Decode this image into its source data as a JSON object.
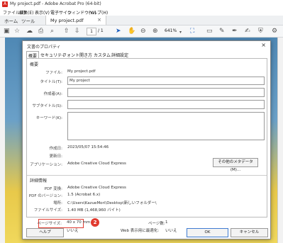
{
  "app": {
    "title": "My project.pdf - Adobe Acrobat Pro (64-bit)"
  },
  "menu": [
    "ファイル(F)",
    "編集(E)",
    "表示(V)",
    "電子サイン",
    "ウィンドウ(W)",
    "ヘルプ(H)"
  ],
  "tabs": {
    "home": "ホーム",
    "tools": "ツール",
    "document": "My project.pdf"
  },
  "toolbar": {
    "page_current": "1",
    "page_total": "/ 1",
    "zoom": "641%"
  },
  "dialog": {
    "title": "文書のプロパティ",
    "tabs": [
      "概要",
      "セキュリティ",
      "フォント",
      "開き方",
      "カスタム",
      "詳細設定"
    ],
    "overview_header": "概要",
    "labels": {
      "file": "ファイル:",
      "title": "タイトル(T):",
      "author": "作成者(A):",
      "subject": "サブタイトル(S):",
      "keywords": "キーワード(K):",
      "created": "作成日:",
      "modified": "更新日:",
      "application": "アプリケーション:"
    },
    "values": {
      "file": "My project.pdf",
      "title": "My project",
      "created": "2023/05/07 15:54:46",
      "modified": "",
      "application": "Adobe Creative Cloud Express"
    },
    "more_metadata_button": "その他のメタデータ(M)...",
    "details_header": "詳細情報",
    "details": {
      "pdf_producer_label": "PDF 変換:",
      "pdf_producer": "Adobe Creative Cloud Express",
      "pdf_version_label": "PDF のバージョン:",
      "pdf_version": "1.5 (Acrobat 6.x)",
      "location_label": "場所:",
      "location": "C:\\Users\\KazueMori\\Desktop\\新しいフォルダー\\",
      "file_size_label": "ファイルサイズ:",
      "file_size": "1.40 MB (1,468,960 バイト)",
      "page_size_label": "ページサイズ:",
      "page_size": "40 x 70 mm",
      "page_count_label": "ページ数:",
      "page_count": "1",
      "tagged_pdf_label": "タグ付き PDF:",
      "tagged_pdf": "いいえ",
      "fast_web_view_label": "Web 表示用に最適化:",
      "fast_web_view": "いいえ"
    },
    "annotation_number": "2",
    "buttons": {
      "help": "ヘルプ",
      "ok": "OK",
      "cancel": "キャンセル"
    }
  }
}
